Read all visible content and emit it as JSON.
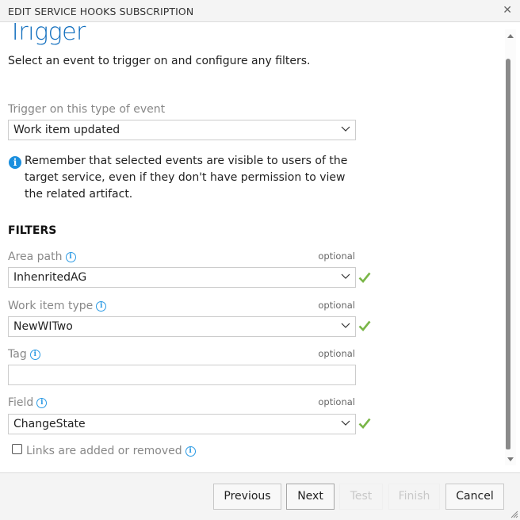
{
  "dialog": {
    "title": "EDIT SERVICE HOOKS SUBSCRIPTION",
    "close_icon": "close-icon"
  },
  "page": {
    "heading": "Trigger",
    "subtitle": "Select an event to trigger on and configure any filters."
  },
  "event": {
    "label": "Trigger on this type of event",
    "value": "Work item updated"
  },
  "notice": {
    "icon": "info-icon",
    "text": "Remember that selected events are visible to users of the target service, even if they don't have permission to view the related artifact."
  },
  "filters": {
    "heading": "FILTERS",
    "area_path": {
      "label": "Area path",
      "optional": "optional",
      "value": "InhenritedAG",
      "valid": true
    },
    "work_item_type": {
      "label": "Work item type",
      "optional": "optional",
      "value": "NewWITwo",
      "valid": true
    },
    "tag": {
      "label": "Tag",
      "optional": "optional",
      "value": "",
      "placeholder": ""
    },
    "field": {
      "label": "Field",
      "optional": "optional",
      "value": "ChangeState",
      "valid": true
    },
    "links": {
      "label": "Links are added or removed",
      "checked": false
    }
  },
  "footer": {
    "previous": "Previous",
    "next": "Next",
    "test": "Test",
    "finish": "Finish",
    "cancel": "Cancel"
  },
  "colors": {
    "accent": "#106ebe",
    "info": "#2b9ae4",
    "valid": "#7ab648"
  }
}
